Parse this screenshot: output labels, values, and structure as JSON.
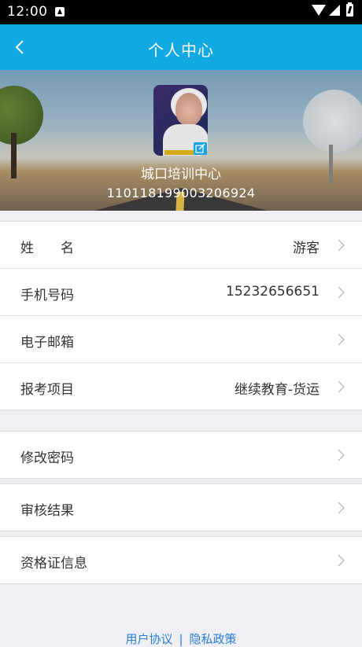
{
  "status_bar": {
    "time": "12:00"
  },
  "app_bar": {
    "title": "个人中心"
  },
  "profile": {
    "org_name": "城口培训中心",
    "id_number": "110118199003206924"
  },
  "info_rows": [
    {
      "label": "姓　　名",
      "value": "游客"
    },
    {
      "label": "手机号码",
      "value": "15232656651"
    },
    {
      "label": "电子邮箱",
      "value": ""
    },
    {
      "label": "报考项目",
      "value": "继续教育-货运"
    }
  ],
  "actions": {
    "change_password": "修改密码",
    "review_result": "审核结果",
    "certificate_info": "资格证信息"
  },
  "footer": {
    "user_agreement": "用户协议",
    "separator": "|",
    "privacy_policy": "隐私政策"
  }
}
